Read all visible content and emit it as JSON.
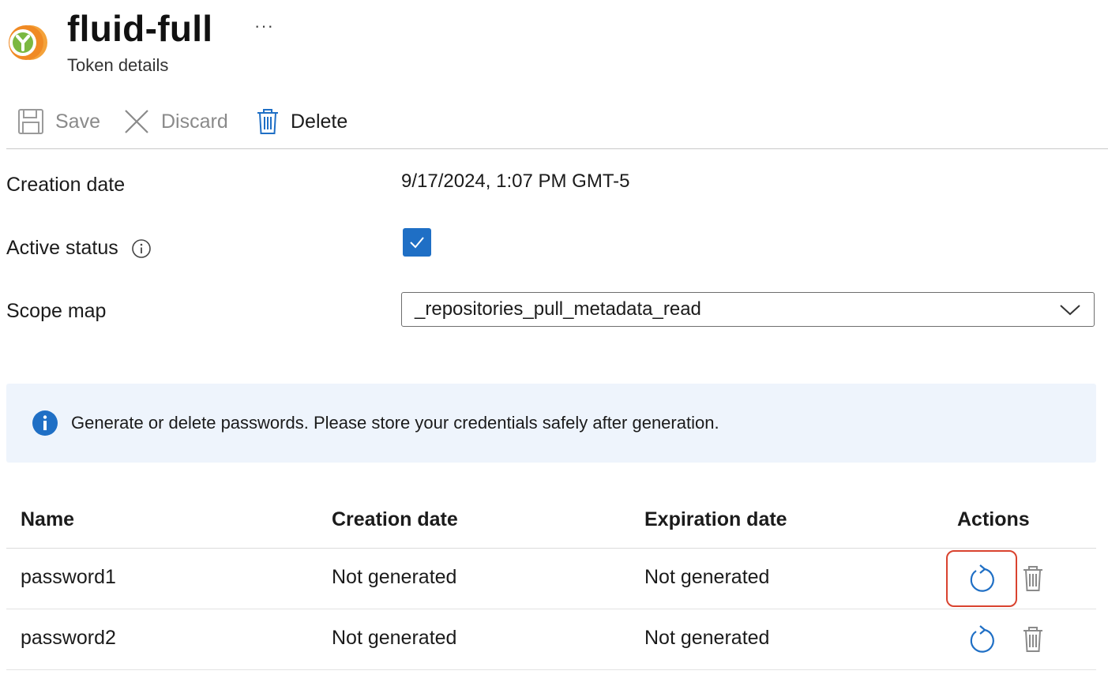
{
  "header": {
    "title": "fluid-full",
    "more_label": "···",
    "subtitle": "Token details"
  },
  "toolbar": {
    "save_label": "Save",
    "discard_label": "Discard",
    "delete_label": "Delete"
  },
  "form": {
    "creation_date_label": "Creation date",
    "creation_date_value": "9/17/2024, 1:07 PM GMT-5",
    "active_status_label": "Active status",
    "active_status_checked": true,
    "scope_map_label": "Scope map",
    "scope_map_value": "_repositories_pull_metadata_read"
  },
  "info_banner": {
    "text": "Generate or delete passwords. Please store your credentials safely after generation."
  },
  "table": {
    "headers": [
      "Name",
      "Creation date",
      "Expiration date",
      "Actions"
    ],
    "rows": [
      {
        "name": "password1",
        "creation_date": "Not generated",
        "expiration_date": "Not generated",
        "highlighted": true
      },
      {
        "name": "password2",
        "creation_date": "Not generated",
        "expiration_date": "Not generated",
        "highlighted": false
      }
    ]
  },
  "colors": {
    "accent": "#1f6fc5",
    "highlight_border": "#d9432f",
    "banner_bg": "#eef4fc",
    "logo_orange": "#f08a24",
    "logo_green": "#7bb841"
  },
  "icons": {
    "logo": "container-registry-logo",
    "save": "save-icon",
    "discard": "close-icon",
    "delete": "trash-icon",
    "info_tooltip": "info-outline-icon",
    "info_banner": "info-filled-icon",
    "checkbox": "checkmark-icon",
    "dropdown": "chevron-down-icon",
    "regenerate": "refresh-icon",
    "row_delete": "trash-icon"
  }
}
